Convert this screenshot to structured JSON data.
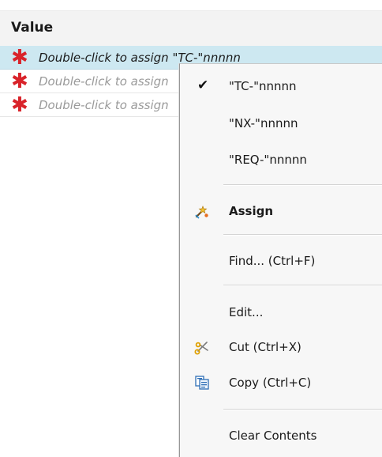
{
  "table": {
    "header": "Value",
    "rows": [
      {
        "text": "Double-click to assign \"TC-\"nnnnn",
        "required": "✱"
      },
      {
        "text": "Double-click to assign",
        "required": "✱"
      },
      {
        "text": "Double-click to assign",
        "required": "✱"
      }
    ]
  },
  "menu": {
    "items": {
      "tc": "\"TC-\"nnnnn",
      "nx": "\"NX-\"nnnnn",
      "req": "\"REQ-\"nnnnn",
      "assign": "Assign",
      "find": "Find... (Ctrl+F)",
      "edit": "Edit...",
      "cut": "Cut (Ctrl+X)",
      "copy": "Copy (Ctrl+C)",
      "clear": "Clear Contents"
    },
    "checked_mark": "✔",
    "icons": {
      "assign": "assign-wand-icon",
      "cut": "scissors-icon",
      "copy": "copy-icon"
    }
  },
  "colors": {
    "selection": "#cde8f1",
    "required": "#d9232a",
    "menu_bg": "#f7f7f7"
  }
}
